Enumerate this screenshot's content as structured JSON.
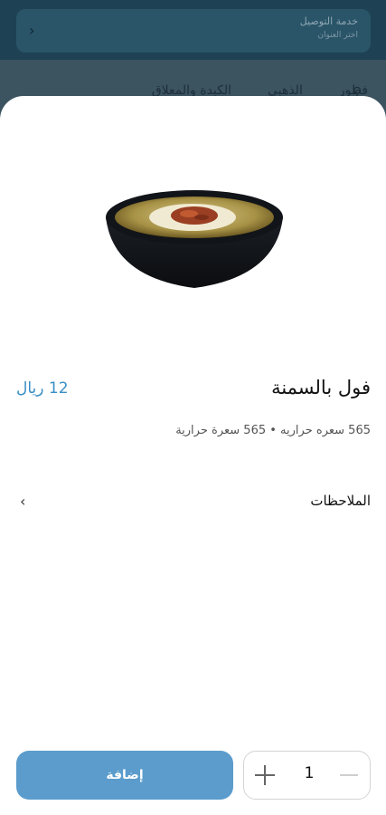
{
  "background": {
    "delivery": {
      "title": "خدمة التوصيل",
      "subtitle": "اختر العنوان"
    },
    "tabs": [
      "فطور",
      "الذهبي",
      "الكبدة والمعلاق"
    ],
    "icons": {
      "chevron": "chevron-left-icon",
      "search": "search-icon"
    }
  },
  "item": {
    "name": "فول بالسمنة",
    "price": "12 ريال",
    "calories": "565 سعره حراريه • 565 سعرة حرارية",
    "image": "ful-bowl-image"
  },
  "notes": {
    "label": "الملاحظات",
    "icon": "chevron-left-icon"
  },
  "cart": {
    "add_label": "إضافة",
    "quantity": "1",
    "plus_icon": "plus-icon",
    "minus_icon": "minus-icon"
  },
  "colors": {
    "accent": "#5b9ccc",
    "price": "#3a8fc4",
    "header": "#1e4154"
  }
}
